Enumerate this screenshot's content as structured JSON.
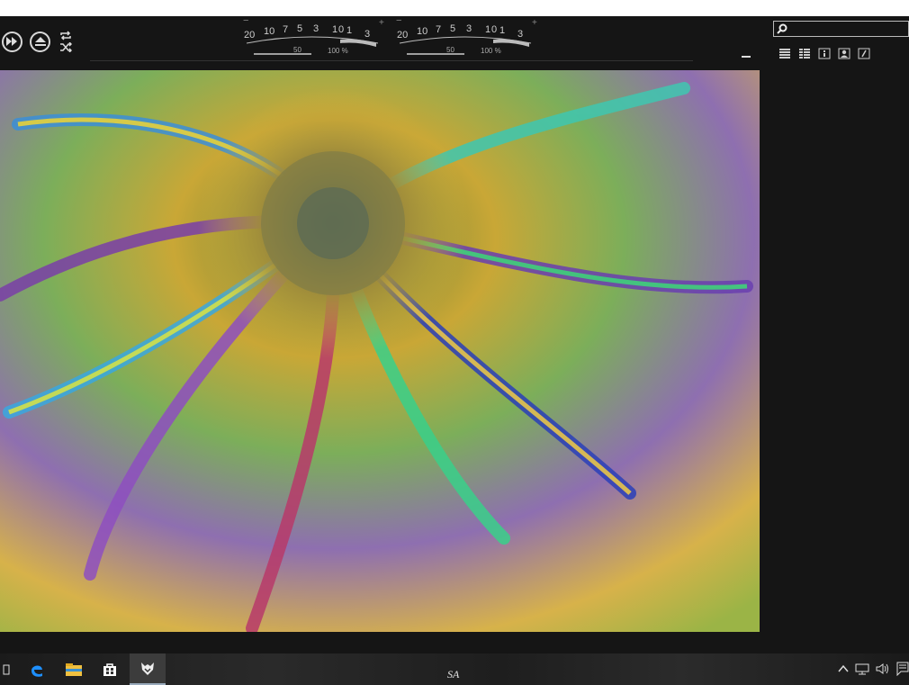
{
  "window": {
    "search": {
      "value": "",
      "placeholder": ""
    },
    "meters": [
      {
        "ticks_top": [
          "20",
          "10",
          "7",
          "5",
          "3",
          "1",
          "0",
          "1",
          "3"
        ],
        "ticks_bottom": [
          "50",
          "100 %"
        ],
        "minus": "−",
        "plus": "+"
      },
      {
        "ticks_top": [
          "20",
          "10",
          "7",
          "5",
          "3",
          "1",
          "0",
          "1",
          "3"
        ],
        "ticks_bottom": [
          "50",
          "100 %"
        ],
        "minus": "−",
        "plus": "+"
      }
    ],
    "icons": {
      "fast_forward": "fast-forward-icon",
      "eject": "eject-icon",
      "repeat": "repeat-icon",
      "shuffle": "shuffle-icon",
      "search": "search-icon",
      "minimize": "minimize-icon",
      "view_list": "list-view-icon",
      "view_detail": "detail-view-icon",
      "info": "info-icon",
      "artist": "artist-icon",
      "lyrics": "lyrics-icon"
    },
    "visualization": {
      "description_colors": [
        "#e3c63a",
        "#3aa8e0",
        "#6a3fb0",
        "#2bd08a",
        "#c84a6b"
      ]
    }
  },
  "taskbar": {
    "signature": "SA",
    "icons": [
      "task-view-icon",
      "edge-icon",
      "file-explorer-icon",
      "store-icon",
      "media-player-app-icon"
    ],
    "tray_icons": [
      "chevron-up-icon",
      "network-icon",
      "volume-icon",
      "notifications-icon"
    ]
  }
}
